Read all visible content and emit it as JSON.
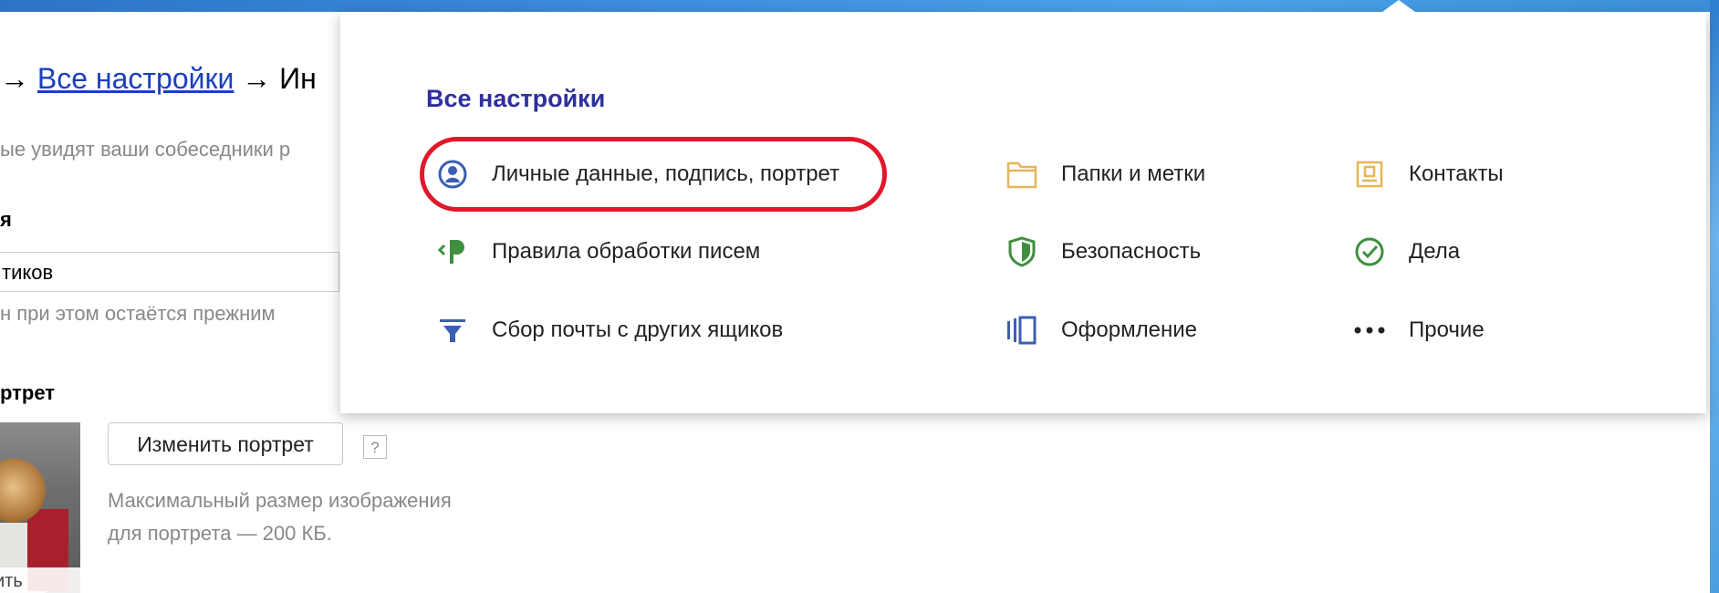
{
  "settings_page": {
    "breadcrumb_arrow_left": "→",
    "breadcrumb_link": "Все настройки",
    "breadcrumb_arrow_right": "→ Ин",
    "subtitle": "ые увидят ваши собеседники р",
    "name_label": "я",
    "name_value": "тиков",
    "name_note": "н при этом остаётся прежним",
    "portrait_label": "ртрет",
    "avatar_caption": "ить",
    "change_portrait_button": "Изменить портрет",
    "help_icon_label": "?",
    "size_note_line1": "Максимальный размер изображения",
    "size_note_line2": "для портрета — 200 КБ."
  },
  "dropdown": {
    "title": "Все настройки",
    "items": [
      {
        "label": "Личные данные, подпись, портрет",
        "icon": "person-icon",
        "color": "#3a5fb0"
      },
      {
        "label": "Правила обработки писем",
        "icon": "rules-icon",
        "color": "#3e8f3e"
      },
      {
        "label": "Сбор почты с других ящиков",
        "icon": "funnel-icon",
        "color": "#3a5fb0"
      },
      {
        "label": "Папки и метки",
        "icon": "folder-icon",
        "color": "#e8b55a"
      },
      {
        "label": "Безопасность",
        "icon": "shield-icon",
        "color": "#3e8f3e"
      },
      {
        "label": "Оформление",
        "icon": "theme-icon",
        "color": "#3a5fb0"
      },
      {
        "label": "Контакты",
        "icon": "contacts-icon",
        "color": "#e8b55a"
      },
      {
        "label": "Дела",
        "icon": "todo-check-icon",
        "color": "#3e8f3e"
      },
      {
        "label": "Прочие",
        "icon": "more-dots-icon",
        "color": "#222222"
      }
    ]
  },
  "highlight_color": "#e3162a"
}
